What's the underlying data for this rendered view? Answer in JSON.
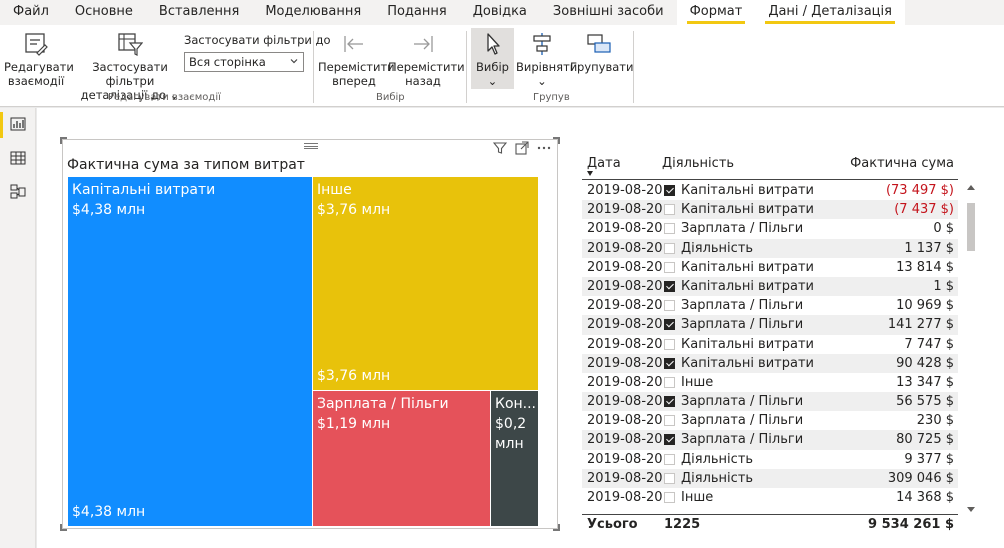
{
  "menu": {
    "items": [
      "Файл",
      "Основне",
      "Вставлення",
      "Моделювання",
      "Подання",
      "Довідка",
      "Зовнішні засоби",
      "Формат",
      "Дані / Деталізація"
    ],
    "active_index": 7
  },
  "ribbon": {
    "edit_interactions": {
      "label_line1": "Редагувати",
      "label_line2": "взаємодії"
    },
    "apply_drill": {
      "label_line1": "Застосувати фільтри",
      "label_line2": "деталізації до"
    },
    "apply_filters_label": "Застосувати фільтри до",
    "apply_filters_value": "Вся сторінка",
    "group_edit_interactions": "Редагувати взаємодії",
    "bring_forward": {
      "label_line1": "Перемістити",
      "label_line2": "вперед"
    },
    "send_backward": {
      "label_line1": "Перемістити",
      "label_line2": "назад"
    },
    "group_arrange": "Вибір",
    "select": {
      "label": "Вибір"
    },
    "align": {
      "label": "Вирівняти"
    },
    "group_btn": {
      "label": "Групувати"
    },
    "group_group": "Групув"
  },
  "treemap": {
    "title": "Фактична сума за типом витрат",
    "tiles": [
      {
        "label": "Капітальні витрати",
        "value": "$4,38 млн",
        "value_bottom": "$4,38 млн",
        "color": "#118dff"
      },
      {
        "label": "Інше",
        "value": "$3,76 млн",
        "value_bottom": "$3,76 млн",
        "color": "#e8c20b"
      },
      {
        "label": "Зарплата / Пільги",
        "value": "$1,19 млн",
        "color": "#e5525a"
      },
      {
        "label": "Кон...",
        "value": "$0,2 млн",
        "color": "#3d4748"
      }
    ]
  },
  "table": {
    "headers": {
      "date": "Дата",
      "activity": "Діяльність",
      "amount": "Фактична сума"
    },
    "rows": [
      {
        "date": "2019-08-20",
        "checked": true,
        "activity": "Капітальні витрати",
        "amount": "(73 497 $)",
        "negative": true
      },
      {
        "date": "2019-08-20",
        "checked": false,
        "activity": "Капітальні витрати",
        "amount": "(7 437 $)",
        "negative": true
      },
      {
        "date": "2019-08-20",
        "checked": false,
        "activity": "Зарплата / Пільги",
        "amount": "0 $",
        "negative": false
      },
      {
        "date": "2019-08-20",
        "checked": false,
        "activity": "Діяльність",
        "amount": "1 137 $",
        "negative": false
      },
      {
        "date": "2019-08-20",
        "checked": false,
        "activity": "Капітальні витрати",
        "amount": "13 814 $",
        "negative": false
      },
      {
        "date": "2019-08-20",
        "checked": true,
        "activity": "Капітальні витрати",
        "amount": "1 $",
        "negative": false
      },
      {
        "date": "2019-08-20",
        "checked": false,
        "activity": "Зарплата / Пільги",
        "amount": "10 969 $",
        "negative": false
      },
      {
        "date": "2019-08-20",
        "checked": true,
        "activity": "Зарплата / Пільги",
        "amount": "141 277 $",
        "negative": false
      },
      {
        "date": "2019-08-20",
        "checked": false,
        "activity": "Капітальні витрати",
        "amount": "7 747 $",
        "negative": false
      },
      {
        "date": "2019-08-20",
        "checked": true,
        "activity": "Капітальні витрати",
        "amount": "90 428 $",
        "negative": false
      },
      {
        "date": "2019-08-20",
        "checked": false,
        "activity": "Інше",
        "amount": "13 347 $",
        "negative": false
      },
      {
        "date": "2019-08-20",
        "checked": true,
        "activity": "Зарплата / Пільги",
        "amount": "56 575 $",
        "negative": false
      },
      {
        "date": "2019-08-20",
        "checked": false,
        "activity": "Зарплата / Пільги",
        "amount": "230 $",
        "negative": false
      },
      {
        "date": "2019-08-20",
        "checked": true,
        "activity": "Зарплата / Пільги",
        "amount": "80 725 $",
        "negative": false
      },
      {
        "date": "2019-08-20",
        "checked": false,
        "activity": "Діяльність",
        "amount": "9 377 $",
        "negative": false
      },
      {
        "date": "2019-08-20",
        "checked": false,
        "activity": "Діяльність",
        "amount": "309 046 $",
        "negative": false
      },
      {
        "date": "2019-08-20",
        "checked": false,
        "activity": "Інше",
        "amount": "14 368 $",
        "negative": false
      }
    ],
    "total": {
      "label": "Усього",
      "count": "1225",
      "amount": "9 534 261 $"
    }
  },
  "colors": {
    "accent": "#f2c811",
    "negative": "#c4141c"
  }
}
